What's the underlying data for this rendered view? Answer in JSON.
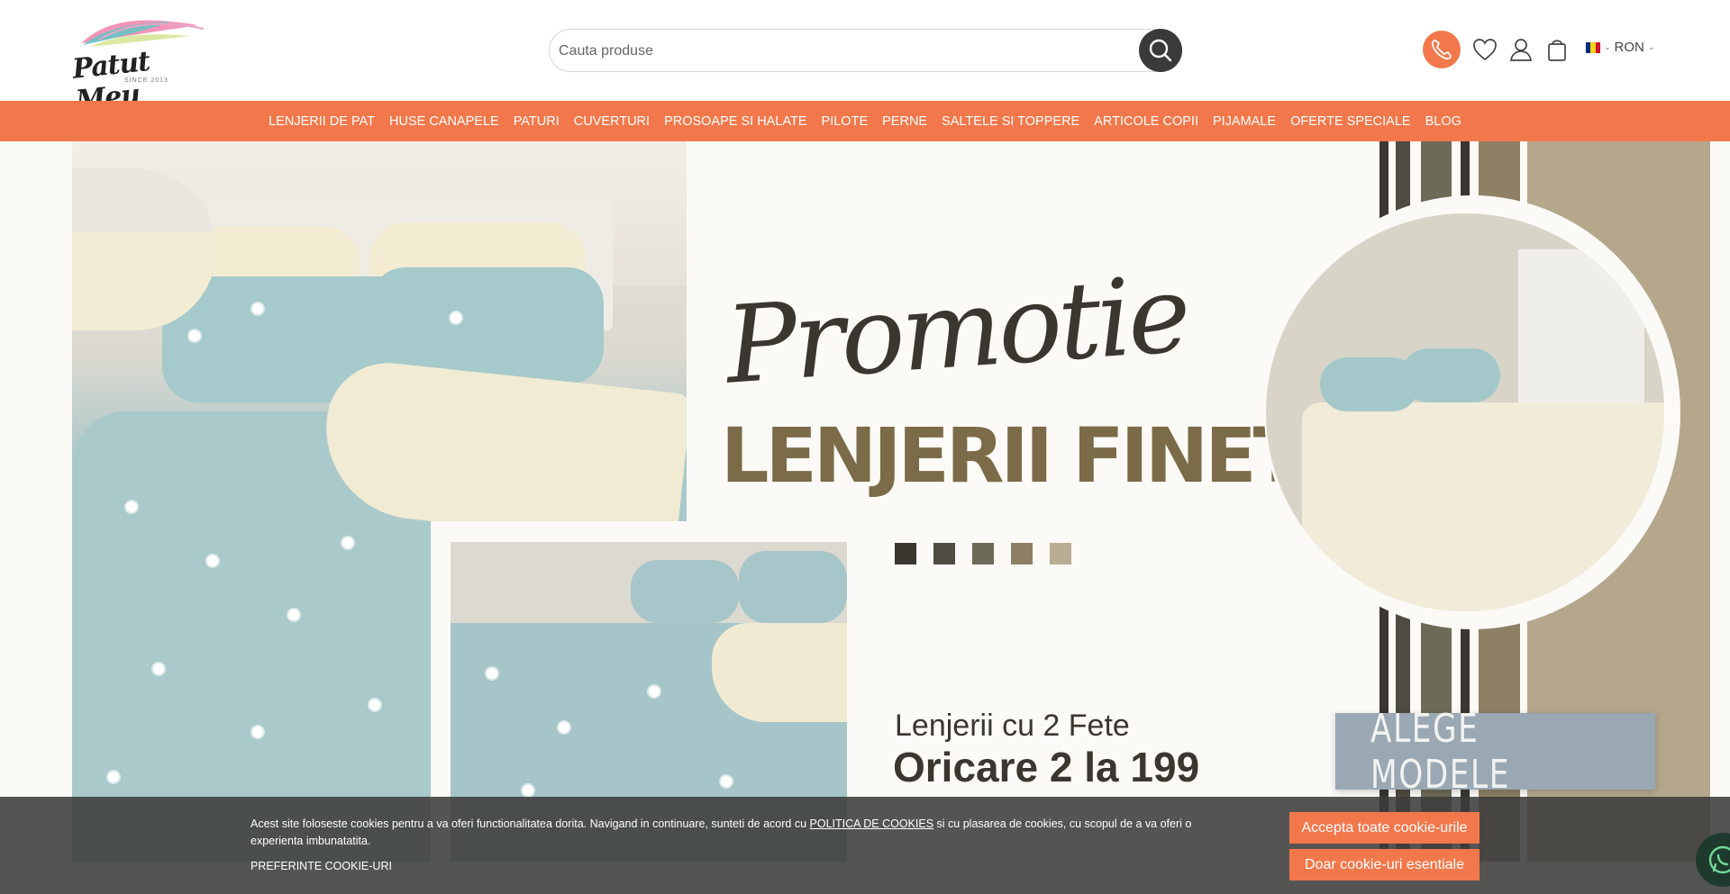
{
  "header": {
    "logo_text": "Patut Meu",
    "logo_since": "SINCE 2013",
    "search_placeholder": "Cauta produse",
    "currency": "RON",
    "icons": [
      "phone-icon",
      "heart-icon",
      "user-icon",
      "bag-icon"
    ]
  },
  "nav": {
    "items": [
      "LENJERII DE PAT",
      "HUSE CANAPELE",
      "PATURI",
      "CUVERTURI",
      "PROSOAPE SI HALATE",
      "PILOTE",
      "PERNE",
      "SALTELE SI TOPPERE",
      "ARTICOLE COPII",
      "PIJAMALE",
      "OFERTE SPECIALE",
      "BLOG"
    ]
  },
  "banner": {
    "script_title": "Promotie",
    "title": "LENJERII FINET",
    "subtitle_1": "Lenjerii cu 2 Fete",
    "subtitle_2": "Oricare 2 la 199",
    "cta": "ALEGE MODELE",
    "swatch_colors": [
      "#3a3630",
      "#4e4b42",
      "#6e6a58",
      "#8d8065",
      "#b8ad92"
    ]
  },
  "cookie": {
    "text_before": "Acest site foloseste cookies pentru a va oferi functionalitatea dorita. Navigand in continuare, sunteti de acord cu ",
    "link": "POLITICA DE COOKIES",
    "text_after": " si cu plasarea de cookies, cu scopul de a va oferi o experienta imbunatatita.",
    "preferences": "PREFERINTE COOKIE-URI",
    "accept_all": "Accepta toate cookie-urile",
    "essential_only": "Doar cookie-uri esentiale"
  },
  "colors": {
    "accent": "#f2784b",
    "dark": "#3a3a3a",
    "brand_brown": "#7b6b48"
  }
}
